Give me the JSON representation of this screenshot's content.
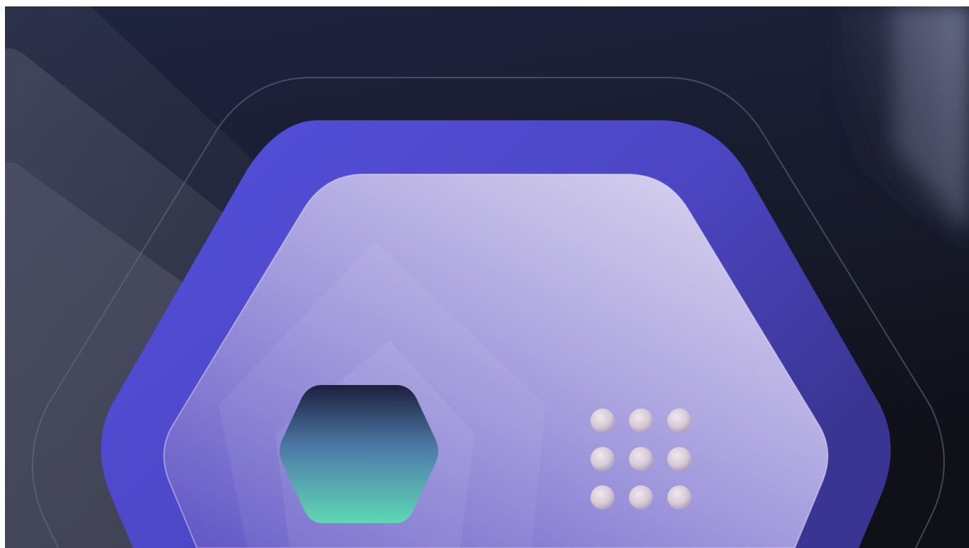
{
  "illustration": {
    "subject": "hexagonal-safe-vault",
    "icons": [
      "vault-body-icon",
      "teal-hexagon-lock-icon",
      "keypad-dots-icon"
    ],
    "keypad": {
      "rows": 3,
      "cols": 3
    },
    "colors": {
      "background_top": "#1f2440",
      "background_bottom": "#0f1018",
      "vault_outer": "#5450de",
      "vault_outer_dark": "#3a3593",
      "vault_face_light": "#d9d3ee",
      "vault_face_mid": "#9f97dd",
      "vault_face_dark": "#6b5fd0",
      "lock_teal": "#5fd8b4",
      "lock_dark": "#1d1f3c",
      "keypad_dot": "#efe7ee",
      "keypad_dot_shade": "#a89ab4",
      "outline_ring": "#6a6f8c"
    }
  }
}
